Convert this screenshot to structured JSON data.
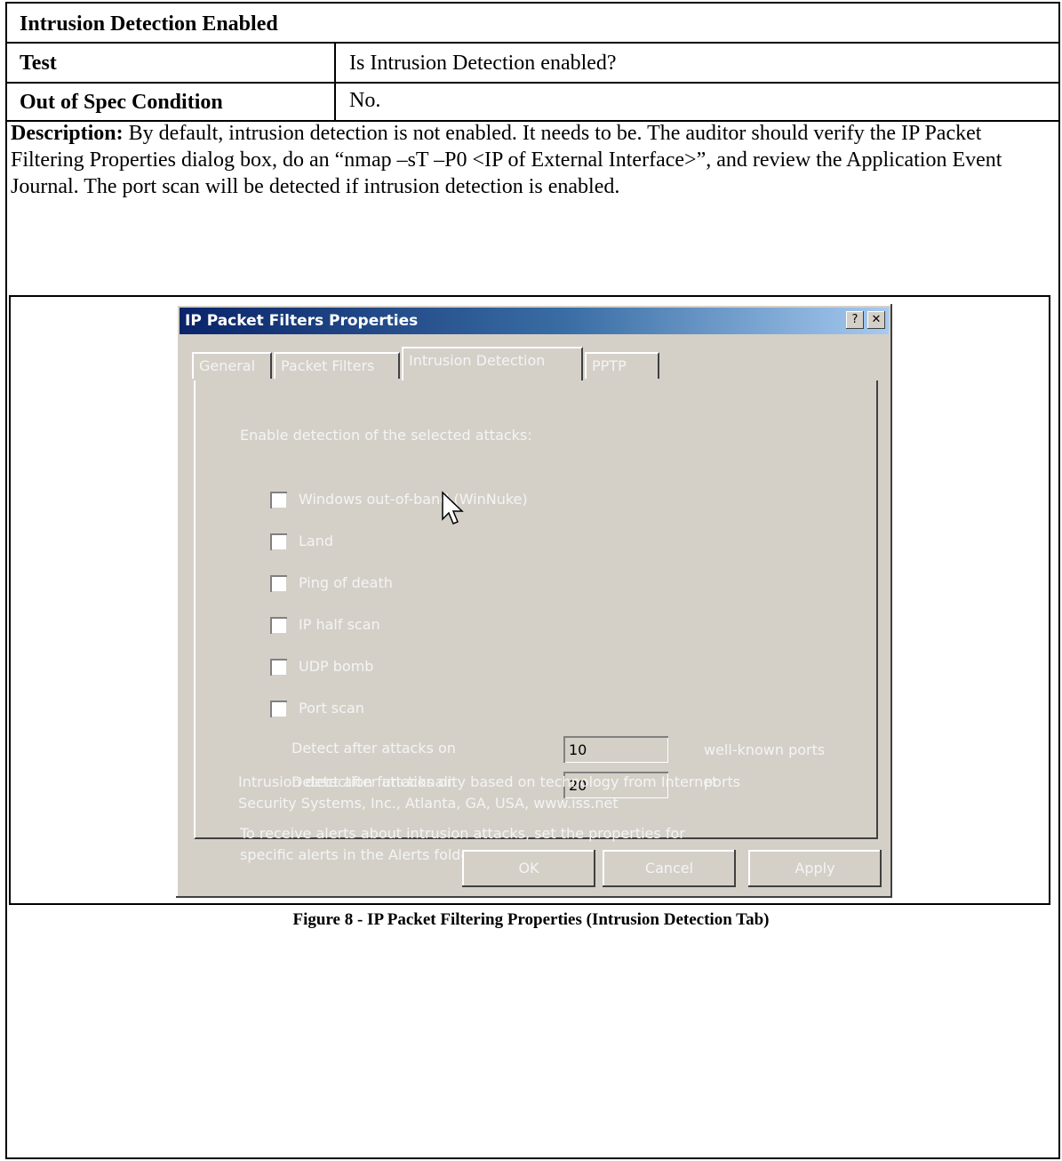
{
  "table": {
    "title": "Intrusion Detection Enabled",
    "test_label": "Test",
    "test_value": "Is Intrusion Detection enabled?",
    "spec_label": "Out of Spec Condition",
    "spec_value": "No.",
    "description_label": "Description:",
    "description_text": " By default, intrusion detection is not enabled.  It needs to be.  The auditor should verify the IP Packet Filtering Properties dialog box, do an “nmap –sT –P0 <IP of External Interface>”, and review the Application Event Journal.  The port scan will be detected if intrusion detection is enabled.",
    "caption": "Figure 8 - IP Packet Filtering Properties (Intrusion Detection Tab)"
  },
  "dialog": {
    "title": "IP Packet Filters Properties",
    "help_glyph": "?",
    "close_glyph": "✕",
    "tabs": [
      {
        "label": "General",
        "active": false
      },
      {
        "label": "Packet Filters",
        "active": false
      },
      {
        "label": "Intrusion Detection",
        "active": true
      },
      {
        "label": "PPTP",
        "active": false
      }
    ],
    "intro": "Enable detection of the selected attacks:",
    "attacks": [
      {
        "label": "Windows out-of-band (WinNuke)",
        "checked": false
      },
      {
        "label": "Land",
        "checked": false
      },
      {
        "label": "Ping of death",
        "checked": false
      },
      {
        "label": "IP half scan",
        "checked": false
      },
      {
        "label": "UDP bomb",
        "checked": false
      },
      {
        "label": "Port scan",
        "checked": false
      }
    ],
    "detect1_label": "Detect after attacks on",
    "detect1_value": "10",
    "detect1_suffix": "well-known ports",
    "detect2_label": "Detect after attacks on",
    "detect2_value": "20",
    "detect2_suffix": "ports",
    "alerts_note_line1": "To receive alerts about intrusion attacks, set the properties for",
    "alerts_note_line2": "specific alerts in the Alerts folder.",
    "iss_note_line1": "Intrusion detection functionality based on technology from Internet",
    "iss_note_line2": "Security Systems, Inc., Atlanta, GA, USA, www.iss.net",
    "buttons": {
      "ok": "OK",
      "cancel": "Cancel",
      "apply": "Apply"
    }
  }
}
